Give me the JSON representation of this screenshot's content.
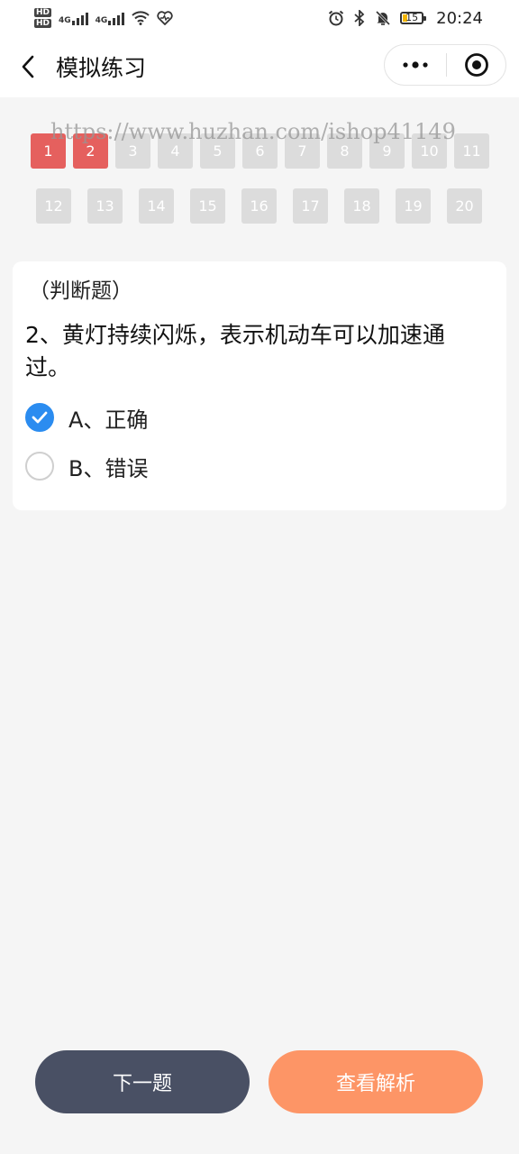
{
  "status_bar": {
    "hd1": "HD",
    "hd2": "HD",
    "net1": "4G",
    "net2": "4G",
    "battery": "15",
    "time": "20:24",
    "icons": [
      "alarm-icon",
      "bluetooth-icon",
      "mute-icon",
      "wifi-icon",
      "heart-icon"
    ]
  },
  "nav": {
    "title": "模拟练习",
    "back_icon": "chevron-left-icon",
    "more_icon": "more-dots-icon",
    "close_icon": "target-circle-icon"
  },
  "question_grid": {
    "rows": [
      [
        {
          "label": "1",
          "status": "wrong"
        },
        {
          "label": "2",
          "status": "wrong"
        },
        {
          "label": "3",
          "status": "unanswered"
        },
        {
          "label": "4",
          "status": "unanswered"
        },
        {
          "label": "5",
          "status": "unanswered"
        },
        {
          "label": "6",
          "status": "unanswered"
        },
        {
          "label": "7",
          "status": "unanswered"
        },
        {
          "label": "8",
          "status": "unanswered"
        },
        {
          "label": "9",
          "status": "unanswered"
        },
        {
          "label": "10",
          "status": "unanswered"
        },
        {
          "label": "11",
          "status": "unanswered"
        }
      ],
      [
        {
          "label": "12",
          "status": "unanswered"
        },
        {
          "label": "13",
          "status": "unanswered"
        },
        {
          "label": "14",
          "status": "unanswered"
        },
        {
          "label": "15",
          "status": "unanswered"
        },
        {
          "label": "16",
          "status": "unanswered"
        },
        {
          "label": "17",
          "status": "unanswered"
        },
        {
          "label": "18",
          "status": "unanswered"
        },
        {
          "label": "19",
          "status": "unanswered"
        },
        {
          "label": "20",
          "status": "unanswered"
        }
      ]
    ]
  },
  "watermark": "https://www.huzhan.com/ishop41149",
  "question": {
    "type": "（判断题）",
    "text": "2、黄灯持续闪烁，表示机动车可以加速通过。",
    "options": [
      {
        "label": "A、正确",
        "checked": true
      },
      {
        "label": "B、错误",
        "checked": false
      }
    ]
  },
  "buttons": {
    "next": "下一题",
    "analysis": "查看解析"
  },
  "colors": {
    "wrong": "#e5605e",
    "unanswered": "#dcdcdc",
    "checked": "#2b8cf0",
    "next_button": "#495064",
    "analysis_button": "#fd9566"
  }
}
